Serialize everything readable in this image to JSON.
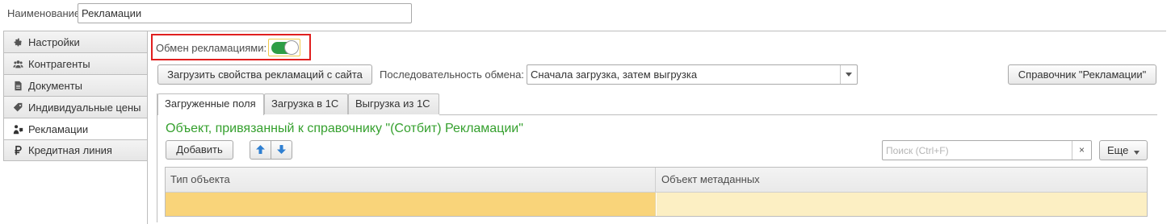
{
  "header": {
    "name_label": "Наименование:",
    "name_value": "Рекламации"
  },
  "sidebar": {
    "items": [
      {
        "label": "Настройки",
        "icon": "gear-icon"
      },
      {
        "label": "Контрагенты",
        "icon": "people-icon"
      },
      {
        "label": "Документы",
        "icon": "document-icon"
      },
      {
        "label": "Индивидуальные цены",
        "icon": "price-tag-icon"
      },
      {
        "label": "Рекламации",
        "icon": "claims-icon",
        "active": true
      },
      {
        "label": "Кредитная линия",
        "icon": "ruble-icon"
      }
    ]
  },
  "exchange": {
    "label": "Обмен рекламациями:",
    "enabled": true,
    "toggle_color": "#2e9e46",
    "highlight_color": "#e01f1f"
  },
  "toolbar": {
    "load_button": "Загрузить свойства рекламаций с сайта",
    "sequence_label": "Последовательность обмена:",
    "sequence_value": "Сначала загрузка, затем выгрузка",
    "reference_button": "Справочник \"Рекламации\""
  },
  "tabs": [
    {
      "label": "Загруженные поля",
      "active": true
    },
    {
      "label": "Загрузка в 1С"
    },
    {
      "label": "Выгрузка из 1С"
    }
  ],
  "group": {
    "title": "Объект, привязанный к справочнику \"(Сотбит) Рекламации\"",
    "title_color": "#35a02e",
    "add_button": "Добавить",
    "search_placeholder": "Поиск (Ctrl+F)",
    "search_clear": "×",
    "more_button": "Еще"
  },
  "table": {
    "columns": [
      "Тип объекта",
      "Объект метаданных"
    ],
    "rows": [
      [
        "",
        ""
      ]
    ],
    "selected_row_color": "#f9d47a"
  }
}
